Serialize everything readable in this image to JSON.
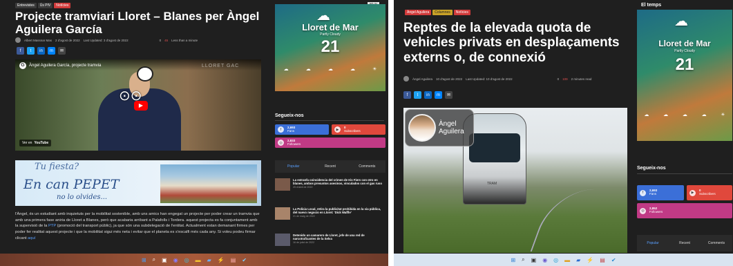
{
  "left": {
    "tags": [
      "Entrevistes",
      "Ús PIV",
      "Notícies"
    ],
    "zoom": "80 %",
    "title": "Projecte tramviari Lloret – Blanes per Àngel Aguilera García",
    "meta": {
      "author": "Albert Massnar Mas",
      "date": "2 d'agost de 2022",
      "updated": "Last Updated: 3 d'agost de 2022",
      "comments": "0",
      "views": "45",
      "readtime": "Less than a minute"
    },
    "video": {
      "title": "Àngel Aguilera García, projecte tramvia",
      "watch_on": "Ver en",
      "watch_brand": "YouTube",
      "watermark": "LLORET GAC"
    },
    "ad": {
      "line1": "Tu fiesta?",
      "line2": "En can PEPET",
      "line3": "no lo olvides..."
    },
    "body_text": "l'Àngel, és un estudiant amb inquietuts per la mobilitat sostenible, amb uns amics han engegat un projecte per poder crear un tramvia que amb una primera fase aniria de Lloret a Blanes, però que acabaria arribant a Palafolls i Tordera. aquest projecta es fa conjuntament amb la supervisió de la ",
    "body_link1": "PTP",
    "body_text2": " (promoció del transport públic), ja que són una subdelegació de l'entitat. Actualment estan demanant firmes per poder fer realitat aquest projecte i que la mobilitat sigui més neta i evitar que el planeta es s'escalfi més cada any. Si voleu podeu firmar clicant ",
    "body_link2": "aquí",
    "weather": {
      "city": "Lloret de Mar",
      "sub": "Partly Cloudy",
      "temp": "21"
    },
    "follow_title": "Segueix-nos",
    "facebook": {
      "count": "2,693",
      "label": "Fans"
    },
    "youtube": {
      "count": "0",
      "label": "Subscribers"
    },
    "instagram": {
      "count": "2,833",
      "label": "Followers"
    },
    "tabs": [
      "Popular",
      "Recent",
      "Comments"
    ],
    "popular": [
      {
        "title": "La estranfa coincidencia del crimen de Iris Fiers con otro en blanes, ambos presuntos asesinos, vinculados con el gas ruso",
        "date": "25 d'abril de 2022"
      },
      {
        "title": "La Policia Local, retira la publicitat prohibida en la via pública, del nuevo negocio en Lloret: 'Dick Waffle'",
        "date": "21 de maig de 2022"
      },
      {
        "title": "Detenido un camarero de Lloret, jefe de una red de narcotraficantes de la Selva",
        "date": "16 de juliol de 2022"
      }
    ]
  },
  "right": {
    "tags": [
      "Àngel Aguilera",
      "Columnes",
      "Notícies"
    ],
    "side_title": "El temps",
    "title": "Reptes de la elevada quota de vehicles privats en desplaçaments externs o, de connexió",
    "meta": {
      "author": "Àngel Aguilera",
      "date": "10 d'agost de 2022",
      "updated": "Last Updated: 10 d'agost de 2022",
      "comments": "0",
      "views": "109",
      "readtime": "2 minutes read"
    },
    "badge_name": "Àngel Aguilera",
    "weather": {
      "city": "Lloret de Mar",
      "sub": "Partly Cloudy",
      "temp": "21"
    },
    "follow_title": "Segueix-nos",
    "facebook": {
      "count": "2,693",
      "label": "Fans"
    },
    "youtube": {
      "count": "0",
      "label": "Subscribers"
    },
    "instagram": {
      "count": "2,852",
      "label": "Followers"
    },
    "tabs": [
      "Popular",
      "Recent",
      "Comments"
    ],
    "tram_text": "TRAM"
  },
  "taskbar_icons": [
    "windows-icon",
    "search-icon",
    "taskview-icon",
    "chat-icon",
    "edge-icon",
    "files-icon",
    "store-icon",
    "bolt-icon",
    "app-icon",
    "check-icon"
  ],
  "colors": {
    "facebook": "#3b6fd8",
    "youtube": "#e0483c",
    "instagram": "#c13a85",
    "background": "#1f1f1f"
  }
}
